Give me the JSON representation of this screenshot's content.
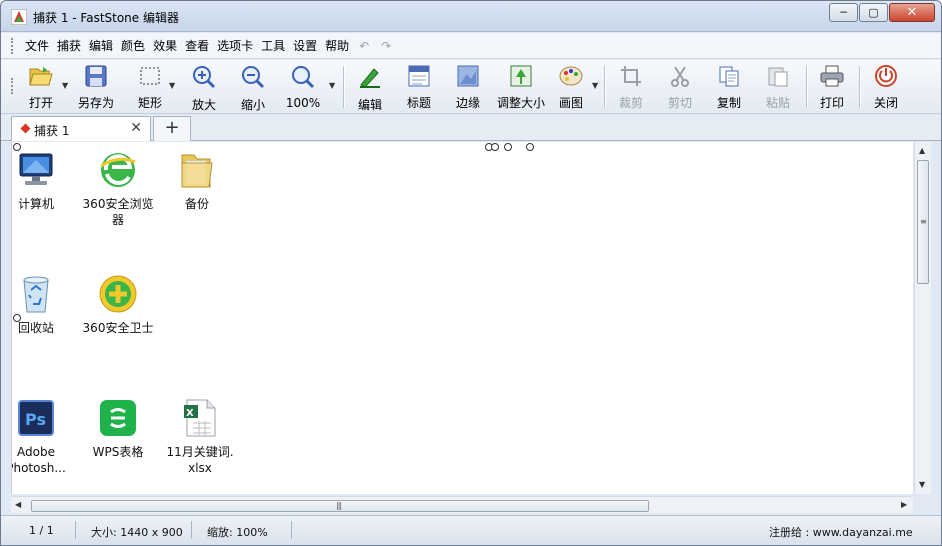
{
  "window": {
    "title": "捕获 1 - FastStone 编辑器",
    "minimize": "─",
    "maximize": "▢",
    "close": "✕"
  },
  "menu": {
    "items": [
      "文件",
      "捕获",
      "编辑",
      "颜色",
      "效果",
      "查看",
      "选项卡",
      "工具",
      "设置",
      "帮助"
    ],
    "undo": "↶",
    "redo": "↷"
  },
  "toolbar": {
    "open": "打开",
    "save_as": "另存为",
    "rect": "矩形",
    "zoom_in": "放大",
    "zoom_out": "缩小",
    "zoom_level": "100%",
    "edit": "编辑",
    "caption": "标题",
    "edge": "边缘",
    "resize": "调整大小",
    "draw": "画图",
    "crop": "裁剪",
    "cut": "剪切",
    "copy": "复制",
    "paste": "粘贴",
    "print": "打印",
    "close": "关闭"
  },
  "tabs": {
    "doc_label": "捕获 1",
    "close": "✕",
    "new": "+"
  },
  "desktop": [
    {
      "label": "计算机",
      "icon": "computer-icon"
    },
    {
      "label": "360安全浏览器",
      "icon": "browser-360-icon"
    },
    {
      "label": "备份",
      "icon": "folder-icon"
    },
    {
      "label": "回收站",
      "icon": "recycle-bin-icon"
    },
    {
      "label": "360安全卫士",
      "icon": "security-360-icon"
    },
    {
      "label": "Adobe Photosh...",
      "icon": "photoshop-icon"
    },
    {
      "label": "WPS表格",
      "icon": "wps-sheet-icon"
    },
    {
      "label": "11月关键词.xlsx",
      "icon": "xlsx-file-icon"
    }
  ],
  "desktop_labels": {
    "computer": "计算机",
    "browser_l1": "360安全浏览",
    "browser_l2": "器",
    "backup": "备份",
    "recycle": "回收站",
    "guard": "360安全卫士",
    "ps_l1": "Adobe",
    "ps_l2": "Photosh...",
    "wps": "WPS表格",
    "xlsx_l1": "11月关键词.",
    "xlsx_l2": "xlsx"
  },
  "status": {
    "page": "1 / 1",
    "size": "大小: 1440 x 900",
    "zoom": "缩放: 100%",
    "registered": "注册给 : www.dayanzai.me"
  },
  "colors": {
    "accent": "#d9381e",
    "toolbar_bg": "#e4eaf2",
    "titlebar_bg": "#c7d6ea"
  }
}
